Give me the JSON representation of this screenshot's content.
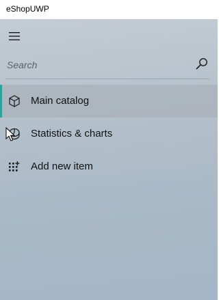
{
  "window": {
    "title": "eShopUWP"
  },
  "colors": {
    "accent": "#2aa39a",
    "icon": "#1a1a1a",
    "text": "#111111",
    "placeholder": "#5b6168"
  },
  "menu": {
    "icon": "hamburger-icon"
  },
  "search": {
    "placeholder": "Search",
    "icon": "search-icon"
  },
  "nav": {
    "items": [
      {
        "label": "Main catalog",
        "icon": "cube-icon",
        "selected": true
      },
      {
        "label": "Statistics & charts",
        "icon": "chart-icon",
        "selected": false
      },
      {
        "label": "Add new item",
        "icon": "add-grid-icon",
        "selected": false
      }
    ]
  }
}
